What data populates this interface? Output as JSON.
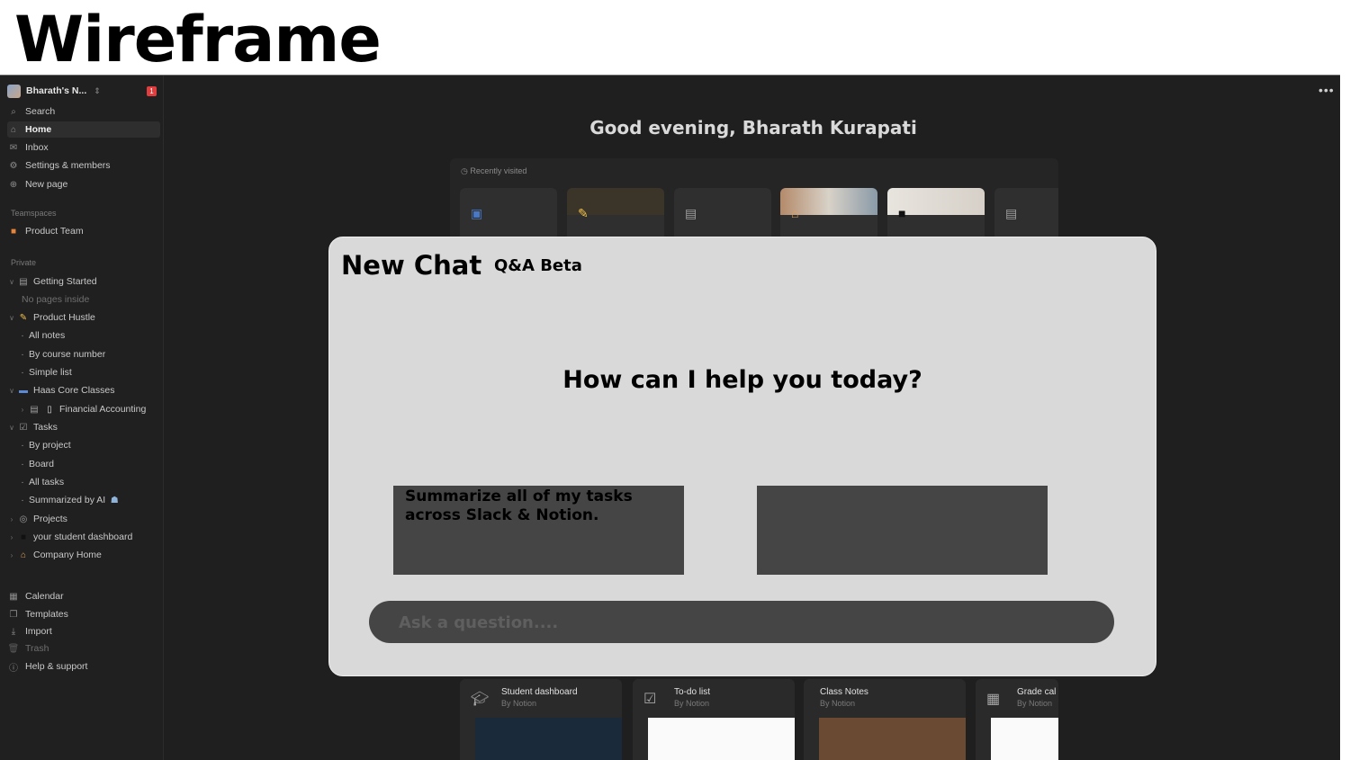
{
  "heading": "Wireframe",
  "sidebar": {
    "workspace_name": "Bharath's N...",
    "badge": "1",
    "top_items": [
      {
        "label": "Search",
        "icon": "search-icon"
      },
      {
        "label": "Home",
        "icon": "home-icon"
      },
      {
        "label": "Inbox",
        "icon": "inbox-icon"
      },
      {
        "label": "Settings & members",
        "icon": "gear-icon"
      },
      {
        "label": "New page",
        "icon": "plus-icon"
      }
    ],
    "teamspaces_label": "Teamspaces",
    "teamspace": "Product Team",
    "private_label": "Private",
    "getting_started": "Getting Started",
    "no_pages": "No pages inside",
    "product_hustle": "Product Hustle",
    "all_notes": "All notes",
    "by_course_number": "By course number",
    "simple_list": "Simple list",
    "haas_core_classes": "Haas Core Classes",
    "financial_accounting": "Financial Accounting",
    "tasks": "Tasks",
    "by_project": "By project",
    "board": "Board",
    "all_tasks": "All tasks",
    "summarized_by_ai": "Summarized by AI",
    "projects": "Projects",
    "student_dashboard": "your student dashboard",
    "company_home": "Company Home",
    "bottom_items": [
      {
        "label": "Calendar",
        "icon": "calendar-icon"
      },
      {
        "label": "Templates",
        "icon": "templates-icon"
      },
      {
        "label": "Import",
        "icon": "import-icon"
      },
      {
        "label": "Trash",
        "icon": "trash-icon"
      },
      {
        "label": "Help & support",
        "icon": "help-icon"
      }
    ]
  },
  "main": {
    "greeting": "Good evening, Bharath Kurapati",
    "recently_visited_label": "Recently visited"
  },
  "modal": {
    "title": "New Chat",
    "mode": "Q&A Beta",
    "prompt": "How can I help you today?",
    "suggestion_1": "Summarize all of my tasks across Slack & Notion.",
    "suggestion_2": "",
    "input_placeholder": "Ask a question...."
  },
  "templates": [
    {
      "title": "Student dashboard",
      "subtitle": "By Notion",
      "icon": "graduation-cap-icon"
    },
    {
      "title": "To-do list",
      "subtitle": "By Notion",
      "icon": "checkbox-icon"
    },
    {
      "title": "Class Notes",
      "subtitle": "By Notion",
      "icon": "notes-icon"
    },
    {
      "title": "Grade cal",
      "subtitle": "By Notion",
      "icon": "calculator-icon"
    }
  ],
  "colors": {
    "app_bg": "#1f1f1f",
    "sidebar_bg": "#202020",
    "modal_bg": "#d9d9d9",
    "suggestion_bg": "#454545",
    "badge": "#e03e3e"
  }
}
